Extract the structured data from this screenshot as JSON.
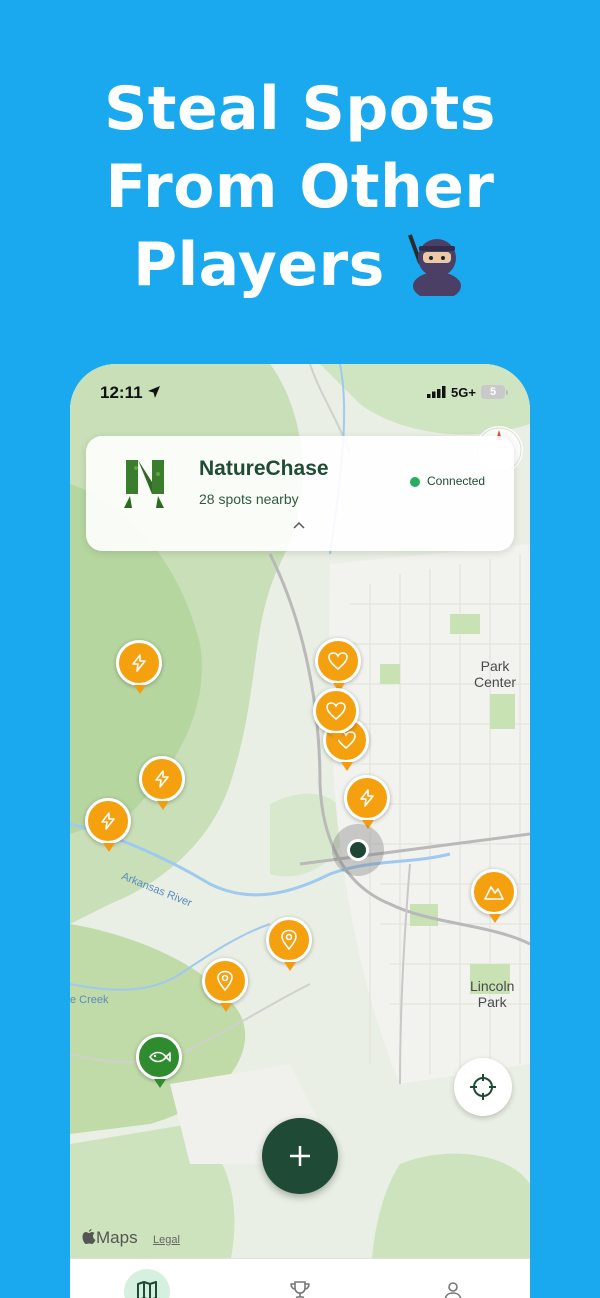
{
  "headline": {
    "line1": "Steal Spots",
    "line2": "From Other",
    "line3": "Players",
    "emoji_icon": "ninja-emoji"
  },
  "status_bar": {
    "time": "12:11",
    "network": "5G+",
    "battery": "5"
  },
  "app_card": {
    "title": "NatureChase",
    "subtitle": "28 spots nearby",
    "connection_status": "Connected",
    "connected_color": "#27ae60"
  },
  "map": {
    "labels": {
      "park_center": "Park\nCenter",
      "lincoln_park": "Lincoln\nPark",
      "river": "Arkansas River",
      "creek": "e Creek"
    },
    "attribution": "Maps",
    "legal": "Legal",
    "pins": [
      {
        "type": "lightning",
        "color": "orange"
      },
      {
        "type": "heart",
        "color": "orange"
      },
      {
        "type": "heart",
        "color": "orange"
      },
      {
        "type": "heart",
        "color": "orange"
      },
      {
        "type": "lightning",
        "color": "orange"
      },
      {
        "type": "lightning",
        "color": "orange"
      },
      {
        "type": "lightning",
        "color": "orange"
      },
      {
        "type": "mountain",
        "color": "orange"
      },
      {
        "type": "location",
        "color": "orange"
      },
      {
        "type": "location",
        "color": "orange"
      },
      {
        "type": "fish",
        "color": "green"
      }
    ]
  },
  "colors": {
    "background": "#1aa9ef",
    "pin_orange": "#f5a00f",
    "pin_green": "#2e8b2e",
    "primary_dark": "#1f4a35"
  },
  "tab_bar": {
    "tabs": [
      {
        "icon": "map-icon",
        "active": true
      },
      {
        "icon": "trophy-icon",
        "active": false
      },
      {
        "icon": "profile-icon",
        "active": false
      }
    ]
  }
}
